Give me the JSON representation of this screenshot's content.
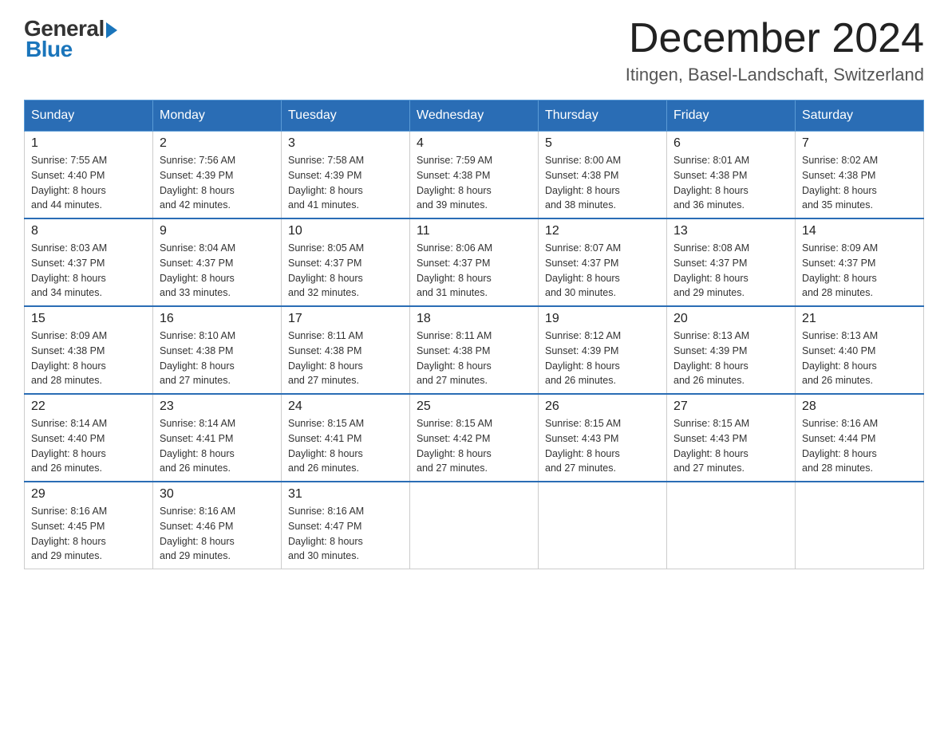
{
  "header": {
    "logo_general": "General",
    "logo_blue": "Blue",
    "title": "December 2024",
    "subtitle": "Itingen, Basel-Landschaft, Switzerland"
  },
  "columns": [
    "Sunday",
    "Monday",
    "Tuesday",
    "Wednesday",
    "Thursday",
    "Friday",
    "Saturday"
  ],
  "weeks": [
    [
      {
        "day": "1",
        "sunrise": "Sunrise: 7:55 AM",
        "sunset": "Sunset: 4:40 PM",
        "daylight": "Daylight: 8 hours",
        "daylight2": "and 44 minutes."
      },
      {
        "day": "2",
        "sunrise": "Sunrise: 7:56 AM",
        "sunset": "Sunset: 4:39 PM",
        "daylight": "Daylight: 8 hours",
        "daylight2": "and 42 minutes."
      },
      {
        "day": "3",
        "sunrise": "Sunrise: 7:58 AM",
        "sunset": "Sunset: 4:39 PM",
        "daylight": "Daylight: 8 hours",
        "daylight2": "and 41 minutes."
      },
      {
        "day": "4",
        "sunrise": "Sunrise: 7:59 AM",
        "sunset": "Sunset: 4:38 PM",
        "daylight": "Daylight: 8 hours",
        "daylight2": "and 39 minutes."
      },
      {
        "day": "5",
        "sunrise": "Sunrise: 8:00 AM",
        "sunset": "Sunset: 4:38 PM",
        "daylight": "Daylight: 8 hours",
        "daylight2": "and 38 minutes."
      },
      {
        "day": "6",
        "sunrise": "Sunrise: 8:01 AM",
        "sunset": "Sunset: 4:38 PM",
        "daylight": "Daylight: 8 hours",
        "daylight2": "and 36 minutes."
      },
      {
        "day": "7",
        "sunrise": "Sunrise: 8:02 AM",
        "sunset": "Sunset: 4:38 PM",
        "daylight": "Daylight: 8 hours",
        "daylight2": "and 35 minutes."
      }
    ],
    [
      {
        "day": "8",
        "sunrise": "Sunrise: 8:03 AM",
        "sunset": "Sunset: 4:37 PM",
        "daylight": "Daylight: 8 hours",
        "daylight2": "and 34 minutes."
      },
      {
        "day": "9",
        "sunrise": "Sunrise: 8:04 AM",
        "sunset": "Sunset: 4:37 PM",
        "daylight": "Daylight: 8 hours",
        "daylight2": "and 33 minutes."
      },
      {
        "day": "10",
        "sunrise": "Sunrise: 8:05 AM",
        "sunset": "Sunset: 4:37 PM",
        "daylight": "Daylight: 8 hours",
        "daylight2": "and 32 minutes."
      },
      {
        "day": "11",
        "sunrise": "Sunrise: 8:06 AM",
        "sunset": "Sunset: 4:37 PM",
        "daylight": "Daylight: 8 hours",
        "daylight2": "and 31 minutes."
      },
      {
        "day": "12",
        "sunrise": "Sunrise: 8:07 AM",
        "sunset": "Sunset: 4:37 PM",
        "daylight": "Daylight: 8 hours",
        "daylight2": "and 30 minutes."
      },
      {
        "day": "13",
        "sunrise": "Sunrise: 8:08 AM",
        "sunset": "Sunset: 4:37 PM",
        "daylight": "Daylight: 8 hours",
        "daylight2": "and 29 minutes."
      },
      {
        "day": "14",
        "sunrise": "Sunrise: 8:09 AM",
        "sunset": "Sunset: 4:37 PM",
        "daylight": "Daylight: 8 hours",
        "daylight2": "and 28 minutes."
      }
    ],
    [
      {
        "day": "15",
        "sunrise": "Sunrise: 8:09 AM",
        "sunset": "Sunset: 4:38 PM",
        "daylight": "Daylight: 8 hours",
        "daylight2": "and 28 minutes."
      },
      {
        "day": "16",
        "sunrise": "Sunrise: 8:10 AM",
        "sunset": "Sunset: 4:38 PM",
        "daylight": "Daylight: 8 hours",
        "daylight2": "and 27 minutes."
      },
      {
        "day": "17",
        "sunrise": "Sunrise: 8:11 AM",
        "sunset": "Sunset: 4:38 PM",
        "daylight": "Daylight: 8 hours",
        "daylight2": "and 27 minutes."
      },
      {
        "day": "18",
        "sunrise": "Sunrise: 8:11 AM",
        "sunset": "Sunset: 4:38 PM",
        "daylight": "Daylight: 8 hours",
        "daylight2": "and 27 minutes."
      },
      {
        "day": "19",
        "sunrise": "Sunrise: 8:12 AM",
        "sunset": "Sunset: 4:39 PM",
        "daylight": "Daylight: 8 hours",
        "daylight2": "and 26 minutes."
      },
      {
        "day": "20",
        "sunrise": "Sunrise: 8:13 AM",
        "sunset": "Sunset: 4:39 PM",
        "daylight": "Daylight: 8 hours",
        "daylight2": "and 26 minutes."
      },
      {
        "day": "21",
        "sunrise": "Sunrise: 8:13 AM",
        "sunset": "Sunset: 4:40 PM",
        "daylight": "Daylight: 8 hours",
        "daylight2": "and 26 minutes."
      }
    ],
    [
      {
        "day": "22",
        "sunrise": "Sunrise: 8:14 AM",
        "sunset": "Sunset: 4:40 PM",
        "daylight": "Daylight: 8 hours",
        "daylight2": "and 26 minutes."
      },
      {
        "day": "23",
        "sunrise": "Sunrise: 8:14 AM",
        "sunset": "Sunset: 4:41 PM",
        "daylight": "Daylight: 8 hours",
        "daylight2": "and 26 minutes."
      },
      {
        "day": "24",
        "sunrise": "Sunrise: 8:15 AM",
        "sunset": "Sunset: 4:41 PM",
        "daylight": "Daylight: 8 hours",
        "daylight2": "and 26 minutes."
      },
      {
        "day": "25",
        "sunrise": "Sunrise: 8:15 AM",
        "sunset": "Sunset: 4:42 PM",
        "daylight": "Daylight: 8 hours",
        "daylight2": "and 27 minutes."
      },
      {
        "day": "26",
        "sunrise": "Sunrise: 8:15 AM",
        "sunset": "Sunset: 4:43 PM",
        "daylight": "Daylight: 8 hours",
        "daylight2": "and 27 minutes."
      },
      {
        "day": "27",
        "sunrise": "Sunrise: 8:15 AM",
        "sunset": "Sunset: 4:43 PM",
        "daylight": "Daylight: 8 hours",
        "daylight2": "and 27 minutes."
      },
      {
        "day": "28",
        "sunrise": "Sunrise: 8:16 AM",
        "sunset": "Sunset: 4:44 PM",
        "daylight": "Daylight: 8 hours",
        "daylight2": "and 28 minutes."
      }
    ],
    [
      {
        "day": "29",
        "sunrise": "Sunrise: 8:16 AM",
        "sunset": "Sunset: 4:45 PM",
        "daylight": "Daylight: 8 hours",
        "daylight2": "and 29 minutes."
      },
      {
        "day": "30",
        "sunrise": "Sunrise: 8:16 AM",
        "sunset": "Sunset: 4:46 PM",
        "daylight": "Daylight: 8 hours",
        "daylight2": "and 29 minutes."
      },
      {
        "day": "31",
        "sunrise": "Sunrise: 8:16 AM",
        "sunset": "Sunset: 4:47 PM",
        "daylight": "Daylight: 8 hours",
        "daylight2": "and 30 minutes."
      },
      null,
      null,
      null,
      null
    ]
  ]
}
